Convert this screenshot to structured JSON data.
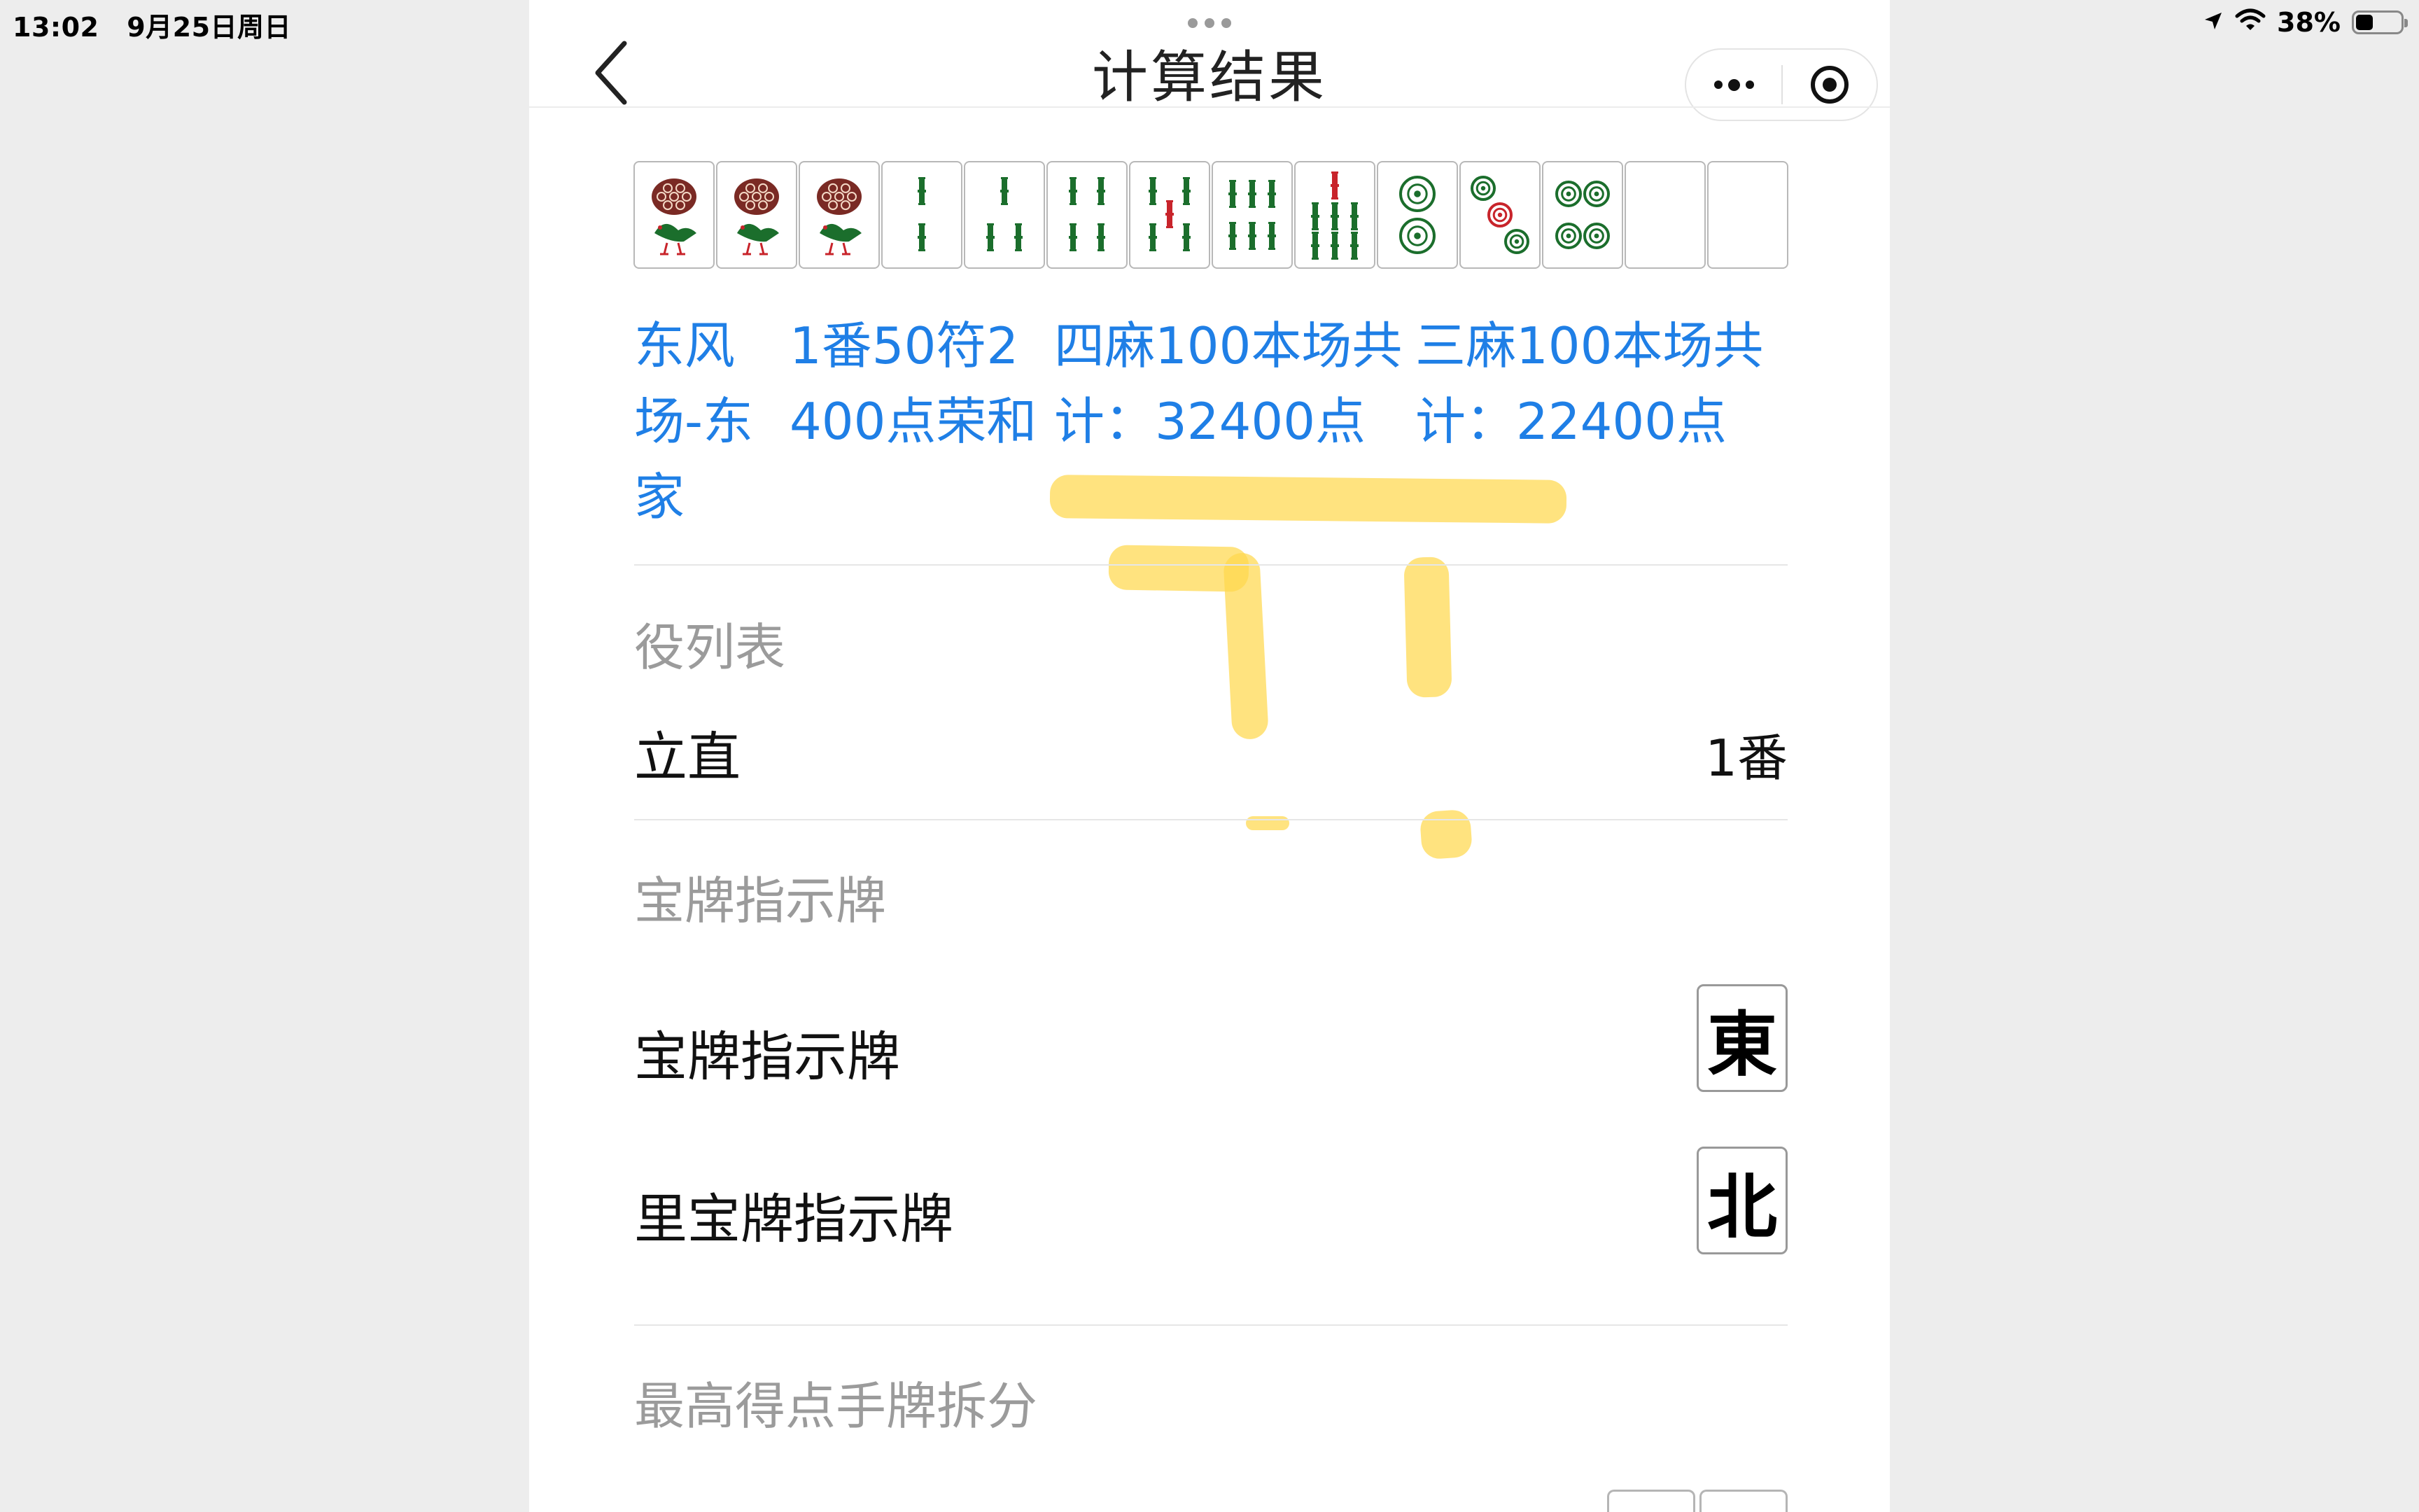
{
  "status_bar": {
    "time": "13:02",
    "date": "9月25日周日",
    "battery": "38%",
    "battery_level": 0.38
  },
  "nav": {
    "title": "计算结果"
  },
  "hand": {
    "tiles": [
      {
        "suit": "bird",
        "name": "1索"
      },
      {
        "suit": "bird",
        "name": "1索"
      },
      {
        "suit": "bird",
        "name": "1索"
      },
      {
        "suit": "sou",
        "name": "2索",
        "rank": 2
      },
      {
        "suit": "sou",
        "name": "3索",
        "rank": 3
      },
      {
        "suit": "sou",
        "name": "4索",
        "rank": 4
      },
      {
        "suit": "sou",
        "name": "5索",
        "rank": 5
      },
      {
        "suit": "sou",
        "name": "6索",
        "rank": 6
      },
      {
        "suit": "sou",
        "name": "7索",
        "rank": 7
      },
      {
        "suit": "pin",
        "name": "2筒",
        "rank": 2
      },
      {
        "suit": "pin",
        "name": "3筒",
        "rank": 3
      },
      {
        "suit": "pin",
        "name": "4筒",
        "rank": 4
      },
      {
        "suit": "blank",
        "name": "空"
      },
      {
        "suit": "blank",
        "name": "空"
      }
    ]
  },
  "result": {
    "seat": "东风场-东家",
    "score": "1番50符2400点荣和",
    "yonma": "四麻100本场共计：32400点",
    "sanma": "三麻100本场共计：22400点"
  },
  "colors": {
    "accent_blue": "#1f7fe6",
    "highlight": "#ffd84d",
    "sou_green": "#1b6e2c",
    "red": "#c8242b"
  },
  "yaku": {
    "header": "役列表",
    "items": [
      {
        "name": "立直",
        "han": "1番"
      }
    ]
  },
  "dora": {
    "header": "宝牌指示牌",
    "indicator_label": "宝牌指示牌",
    "indicator_tile": "東",
    "ura_label": "里宝牌指示牌",
    "ura_tile": "北"
  },
  "breakdown": {
    "header": "最高得点手牌拆分"
  }
}
